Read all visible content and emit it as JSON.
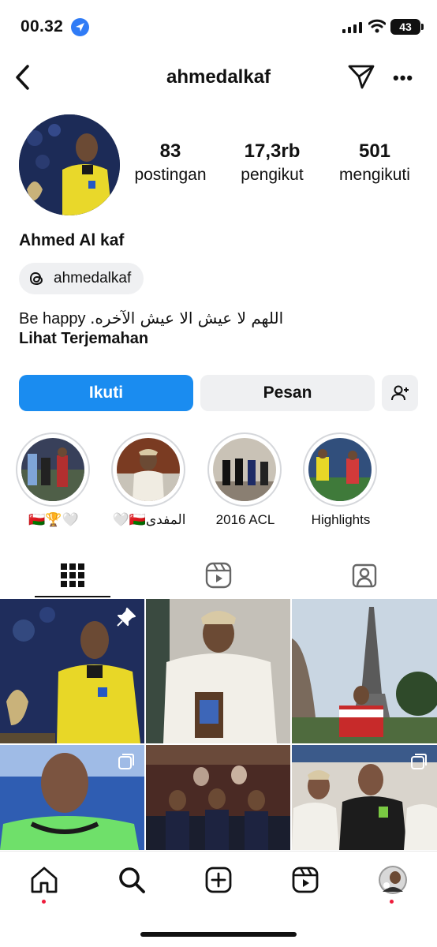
{
  "status_bar": {
    "time": "00.32",
    "battery": "43"
  },
  "header": {
    "username": "ahmedalkaf"
  },
  "profile": {
    "name": "Ahmed Al kaf",
    "threads_handle": "ahmedalkaf",
    "bio_en": "Be happy",
    "bio_ar": "اللهم لا عيش الا عيش الآخره.",
    "translate_link": "Lihat Terjemahan"
  },
  "stats": [
    {
      "value": "83",
      "label": "postingan"
    },
    {
      "value": "17,3rb",
      "label": "pengikut"
    },
    {
      "value": "501",
      "label": "mengikuti"
    }
  ],
  "buttons": {
    "follow": "Ikuti",
    "message": "Pesan"
  },
  "highlights": [
    {
      "label": "🇴🇲🏆🤍"
    },
    {
      "label": "المفدى🇴🇲🤍"
    },
    {
      "label": "2016 ACL"
    },
    {
      "label": "Highlights"
    }
  ],
  "tabs": [
    "grid-icon",
    "reels-icon",
    "tagged-icon"
  ],
  "colors": {
    "accent": "#1a8cf0",
    "button_bg": "#eff0f2",
    "referee_yellow": "#e8d727"
  }
}
